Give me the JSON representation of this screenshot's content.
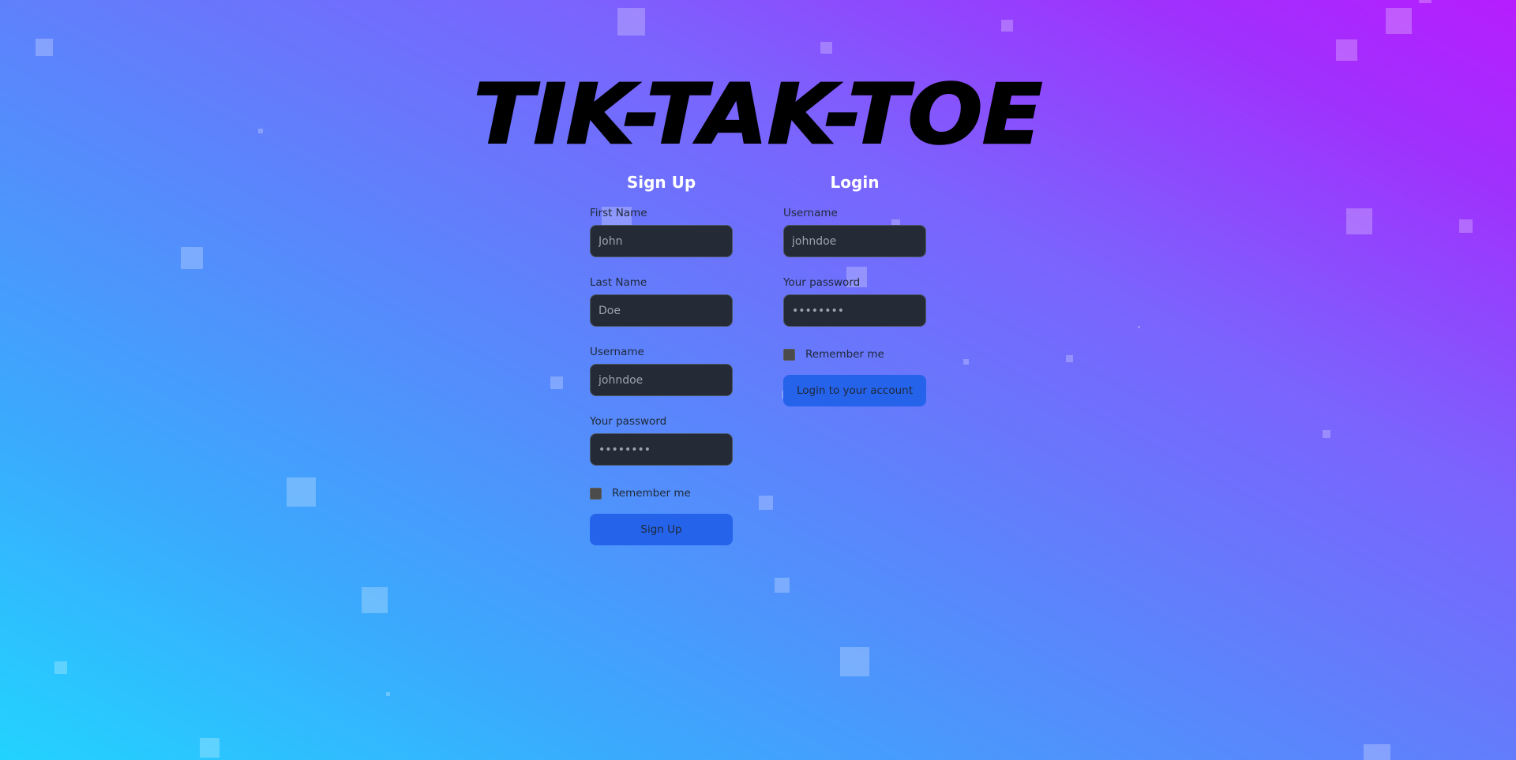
{
  "logo": {
    "text": "TIK-TAK-TOE"
  },
  "signup": {
    "title": "Sign Up",
    "first_name": {
      "label": "First Name",
      "placeholder": "John",
      "value": ""
    },
    "last_name": {
      "label": "Last Name",
      "placeholder": "Doe",
      "value": ""
    },
    "username": {
      "label": "Username",
      "placeholder": "johndoe",
      "value": ""
    },
    "password": {
      "label": "Your password",
      "placeholder": "••••••••",
      "value": ""
    },
    "remember_label": "Remember me",
    "remember_checked": false,
    "submit_label": "Sign Up"
  },
  "login": {
    "title": "Login",
    "username": {
      "label": "Username",
      "placeholder": "johndoe",
      "value": ""
    },
    "password": {
      "label": "Your password",
      "placeholder": "••••••••",
      "value": ""
    },
    "remember_label": "Remember me",
    "remember_checked": false,
    "submit_label": "Login to your account"
  },
  "colors": {
    "gradient_bottom_left": "#22d3fe",
    "gradient_top_right": "#b61dfe",
    "input_bg": "#252b36",
    "button_bg": "#2563eb",
    "heading_text": "#ffffff",
    "label_text": "#1f2937"
  }
}
